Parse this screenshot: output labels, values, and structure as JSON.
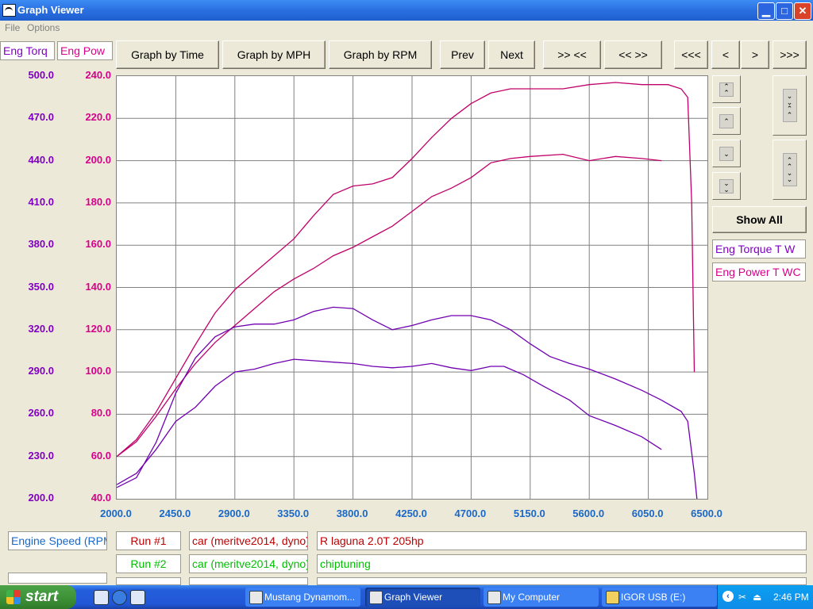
{
  "window": {
    "title": "Graph Viewer"
  },
  "menu": {
    "file": "File",
    "options": "Options"
  },
  "toolbar": {
    "graph_time": "Graph by Time",
    "graph_mph": "Graph by MPH",
    "graph_rpm": "Graph by RPM",
    "prev": "Prev",
    "next": "Next",
    "zoom_in": ">> <<",
    "zoom_out": "<< >>",
    "first": "<<<",
    "left": "<",
    "right": ">",
    "last": ">>>"
  },
  "axis_tabs": {
    "torque": "Eng Torq",
    "power": "Eng Pow"
  },
  "right_panel": {
    "show_all": "Show All",
    "legend_torque": "Eng Torque T W",
    "legend_power": "Eng Power T WC"
  },
  "bottom": {
    "xaxis_name": "Engine Speed (RPM)",
    "run1_label": "Run #1",
    "run1_car": "car (meritve2014, dyno)",
    "run1_desc": "R laguna 2.0T 205hp",
    "run2_label": "Run #2",
    "run2_car": "car (meritve2014, dyno)",
    "run2_desc": "chiptuning"
  },
  "taskbar": {
    "start": "start",
    "items": [
      "Mustang Dynamom...",
      "Graph Viewer",
      "My Computer",
      "IGOR USB (E:)"
    ],
    "clock": "2:46 PM"
  },
  "colors": {
    "torque": "#8000c0",
    "power": "#d8008a",
    "axis_x": "#1a68c8",
    "run1": "#c00000",
    "run2": "#00c000"
  },
  "chart_data": {
    "type": "line",
    "x_ticks": [
      "2000.0",
      "2450.0",
      "2900.0",
      "3350.0",
      "3800.0",
      "4250.0",
      "4700.0",
      "5150.0",
      "5600.0",
      "6050.0",
      "6500.0"
    ],
    "y_torque_ticks": [
      "500.0",
      "470.0",
      "440.0",
      "410.0",
      "380.0",
      "350.0",
      "320.0",
      "290.0",
      "260.0",
      "230.0",
      "200.0"
    ],
    "y_power_ticks": [
      "240.0",
      "220.0",
      "200.0",
      "180.0",
      "160.0",
      "140.0",
      "120.0",
      "100.0",
      "80.0",
      "60.0",
      "40.0"
    ],
    "xlim": [
      2000,
      6500
    ],
    "torque_lim": [
      200,
      500
    ],
    "power_lim": [
      40,
      240
    ],
    "series": [
      {
        "axis": "power",
        "color": "#c0006a",
        "points": [
          [
            2000,
            60
          ],
          [
            2150,
            68
          ],
          [
            2300,
            81
          ],
          [
            2450,
            97
          ],
          [
            2600,
            113
          ],
          [
            2750,
            128
          ],
          [
            2900,
            139
          ],
          [
            3050,
            147
          ],
          [
            3200,
            155
          ],
          [
            3350,
            163
          ],
          [
            3500,
            174
          ],
          [
            3650,
            184
          ],
          [
            3800,
            188
          ],
          [
            3950,
            189
          ],
          [
            4100,
            192
          ],
          [
            4250,
            201
          ],
          [
            4400,
            211
          ],
          [
            4550,
            220
          ],
          [
            4700,
            227
          ],
          [
            4850,
            232
          ],
          [
            5000,
            234
          ],
          [
            5150,
            234
          ],
          [
            5400,
            234
          ],
          [
            5600,
            236
          ],
          [
            5800,
            237
          ],
          [
            6000,
            236
          ],
          [
            6200,
            236
          ],
          [
            6300,
            234
          ],
          [
            6350,
            230
          ],
          [
            6380,
            180
          ],
          [
            6400,
            100
          ]
        ]
      },
      {
        "axis": "power",
        "color": "#c0006a",
        "points": [
          [
            2000,
            60
          ],
          [
            2150,
            67
          ],
          [
            2300,
            79
          ],
          [
            2450,
            92
          ],
          [
            2600,
            104
          ],
          [
            2750,
            114
          ],
          [
            2900,
            122
          ],
          [
            3050,
            130
          ],
          [
            3200,
            138
          ],
          [
            3350,
            144
          ],
          [
            3500,
            149
          ],
          [
            3650,
            155
          ],
          [
            3800,
            159
          ],
          [
            3950,
            164
          ],
          [
            4100,
            169
          ],
          [
            4250,
            176
          ],
          [
            4400,
            183
          ],
          [
            4550,
            187
          ],
          [
            4700,
            192
          ],
          [
            4850,
            199
          ],
          [
            5000,
            201
          ],
          [
            5150,
            202
          ],
          [
            5400,
            203
          ],
          [
            5600,
            200
          ],
          [
            5800,
            202
          ],
          [
            6000,
            201
          ],
          [
            6150,
            200
          ]
        ]
      },
      {
        "axis": "torque",
        "color": "#7000b0",
        "points": [
          [
            2000,
            208
          ],
          [
            2150,
            215
          ],
          [
            2300,
            240
          ],
          [
            2450,
            275
          ],
          [
            2600,
            300
          ],
          [
            2750,
            315
          ],
          [
            2900,
            322
          ],
          [
            3050,
            324
          ],
          [
            3200,
            324
          ],
          [
            3350,
            327
          ],
          [
            3500,
            333
          ],
          [
            3650,
            336
          ],
          [
            3800,
            335
          ],
          [
            3950,
            327
          ],
          [
            4100,
            320
          ],
          [
            4250,
            323
          ],
          [
            4400,
            327
          ],
          [
            4550,
            330
          ],
          [
            4700,
            330
          ],
          [
            4850,
            327
          ],
          [
            5000,
            320
          ],
          [
            5150,
            310
          ],
          [
            5300,
            301
          ],
          [
            5450,
            296
          ],
          [
            5600,
            292
          ],
          [
            5800,
            285
          ],
          [
            6000,
            277
          ],
          [
            6150,
            270
          ],
          [
            6300,
            262
          ],
          [
            6350,
            255
          ],
          [
            6400,
            218
          ],
          [
            6420,
            200
          ]
        ]
      },
      {
        "axis": "torque",
        "color": "#7000b0",
        "points": [
          [
            2000,
            210
          ],
          [
            2150,
            218
          ],
          [
            2300,
            235
          ],
          [
            2450,
            255
          ],
          [
            2600,
            265
          ],
          [
            2750,
            280
          ],
          [
            2900,
            290
          ],
          [
            3050,
            292
          ],
          [
            3200,
            296
          ],
          [
            3350,
            299
          ],
          [
            3500,
            298
          ],
          [
            3650,
            297
          ],
          [
            3800,
            296
          ],
          [
            3950,
            294
          ],
          [
            4100,
            293
          ],
          [
            4250,
            294
          ],
          [
            4400,
            296
          ],
          [
            4550,
            293
          ],
          [
            4700,
            291
          ],
          [
            4850,
            294
          ],
          [
            4950,
            294
          ],
          [
            5100,
            288
          ],
          [
            5250,
            280
          ],
          [
            5450,
            270
          ],
          [
            5600,
            259
          ],
          [
            5800,
            252
          ],
          [
            6000,
            244
          ],
          [
            6150,
            235
          ]
        ]
      }
    ]
  }
}
